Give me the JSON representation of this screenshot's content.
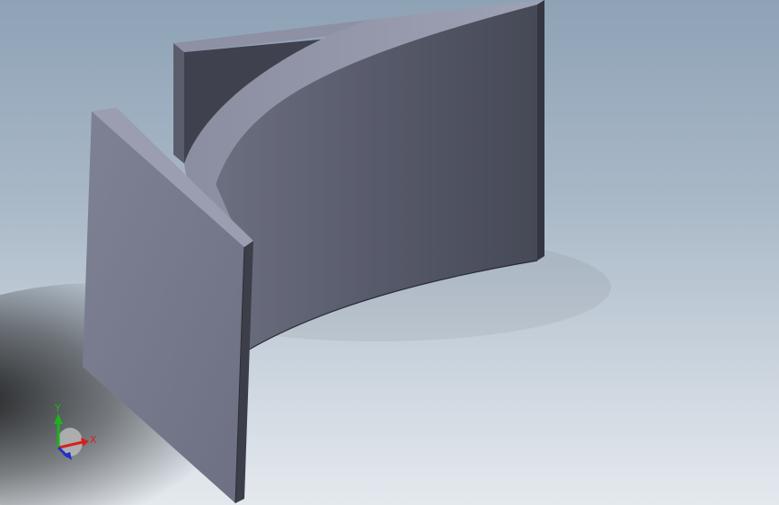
{
  "viewport": {
    "background_top": "#8ea2b6",
    "background_bottom": "#e4e9ee",
    "model_color": "#5d6070"
  },
  "triad": {
    "x_label": "X",
    "y_label": "Y",
    "x_color": "#d42020",
    "y_color": "#1db31d",
    "z_color": "#2030c8"
  }
}
